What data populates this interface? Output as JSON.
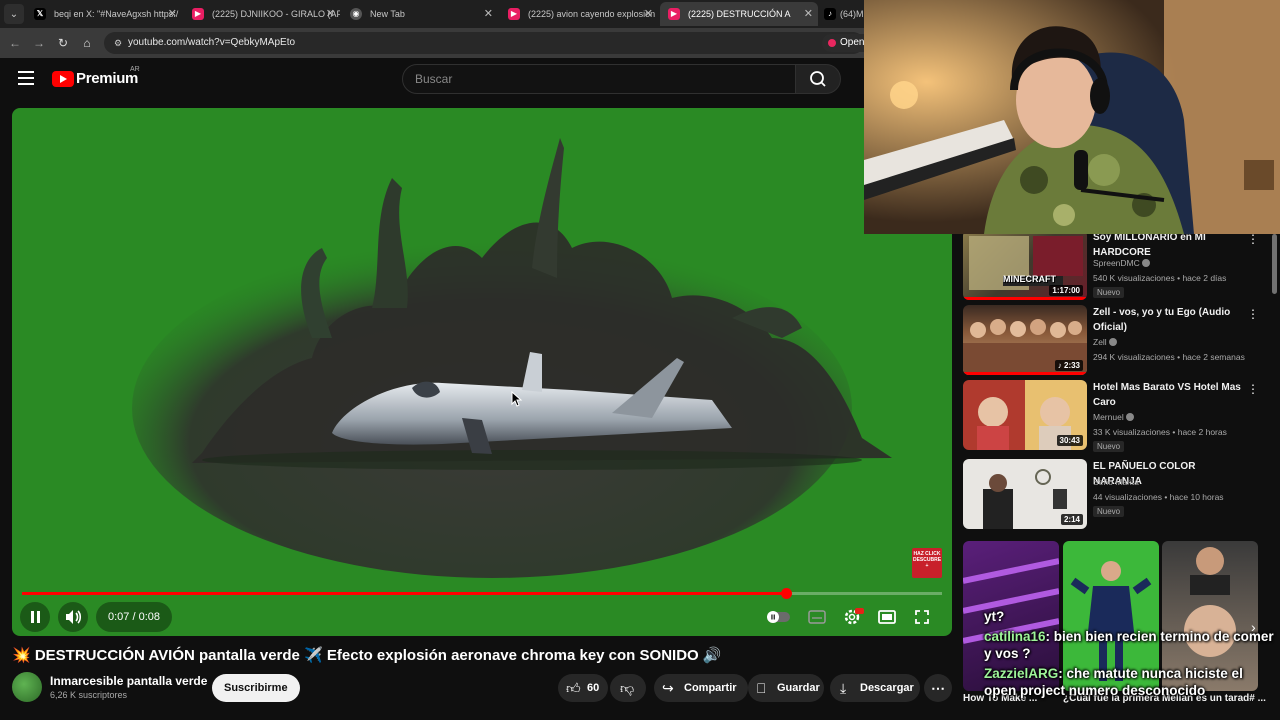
{
  "browser": {
    "tabs": [
      {
        "label": "beqi en X: \"#NaveAgxsh https:/",
        "icon": "x-logo-icon",
        "active": false
      },
      {
        "label": "(2225) DJNIIKOO - GIRALO (AFI",
        "icon": "youtube-icon",
        "active": false
      },
      {
        "label": "New Tab",
        "icon": "chrome-icon",
        "active": false
      },
      {
        "label": "(2225) avion cayendo explosion",
        "icon": "youtube-icon",
        "active": false
      },
      {
        "label": "(2225)  DESTRUCCIÓN A",
        "icon": "youtube-icon",
        "active": true
      },
      {
        "label": "(64)Mu",
        "icon": "tiktok-icon",
        "active": false
      }
    ],
    "url": "youtube.com/watch?v=QebkyMApEto",
    "open_label": "Open"
  },
  "youtube": {
    "logo_word": "Premium",
    "region": "AR",
    "search_placeholder": "Buscar"
  },
  "player": {
    "time": "0:07 / 0:08",
    "progress_fraction": 0.83,
    "cta_text": "HAZ CLICK DESCUBRE +"
  },
  "video": {
    "title": "💥 DESTRUCCIÓN AVIÓN pantalla verde ✈️ Efecto explosión aeronave chroma key con SONIDO 🔊",
    "channel": "Inmarcesible pantalla verde",
    "subscribers": "6,26 K suscriptores",
    "subscribe_label": "Suscribirme",
    "likes": "60",
    "share_label": "Compartir",
    "save_label": "Guardar",
    "download_label": "Descargar"
  },
  "recommendations": [
    {
      "title": "Soy MILLONARIO en MI HARDCORE",
      "channel": "SpreenDMC",
      "verified": true,
      "meta": "540 K visualizaciones • hace 2 días",
      "badge": "Nuevo",
      "duration": "1:17:00",
      "thumb_text": "MINECRAFT"
    },
    {
      "title": "Zell - vos, yo y tu Ego (Audio Oficial)",
      "channel": "Zell",
      "verified": true,
      "meta": "294 K visualizaciones • hace 2 semanas",
      "badge": "",
      "duration": "♪ 2:33"
    },
    {
      "title": "Hotel Mas Barato VS Hotel Mas Caro",
      "channel": "Mernuel",
      "verified": true,
      "meta": "33 K visualizaciones • hace 2 horas",
      "badge": "Nuevo",
      "duration": "30:43"
    },
    {
      "title": "EL PAÑUELO COLOR NARANJA",
      "channel": "Seño Marita",
      "verified": false,
      "meta": "44 visualizaciones • hace 10 horas",
      "badge": "Nuevo",
      "duration": "2:14"
    }
  ],
  "shorts": [
    {
      "caption": "How To Make ..."
    },
    {
      "caption": "¿Cuál fue la primera ..."
    },
    {
      "caption": "Melian es un tarad# ..."
    }
  ],
  "chat": [
    {
      "user": "",
      "message": "yt?"
    },
    {
      "user": "catilina16",
      "message": ": bien bien recien termino de comer y vos ?"
    },
    {
      "user": "ZazzielARG",
      "message": ": che matute nunca hiciste el open project numero desconocido"
    }
  ]
}
